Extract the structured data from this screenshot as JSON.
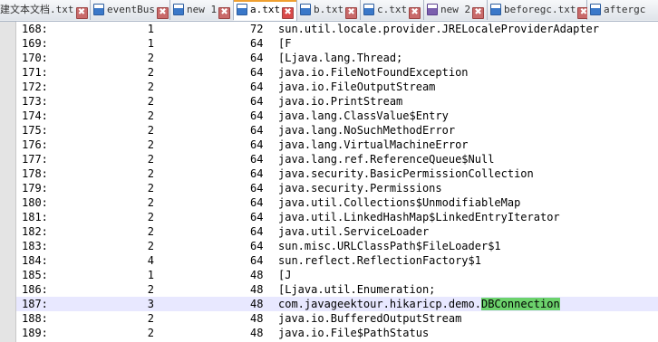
{
  "tabs": [
    {
      "label": "建文本文档.txt",
      "icon": "text-file-icon",
      "active": false
    },
    {
      "label": "eventBus",
      "icon": "text-file-icon",
      "active": false
    },
    {
      "label": "new 1",
      "icon": "text-file-icon",
      "active": false
    },
    {
      "label": "a.txt",
      "icon": "text-file-icon",
      "active": true
    },
    {
      "label": "b.txt",
      "icon": "text-file-icon",
      "active": false
    },
    {
      "label": "c.txt",
      "icon": "text-file-icon",
      "active": false
    },
    {
      "label": "new 2",
      "icon": "purple-file-icon",
      "active": false
    },
    {
      "label": "beforegc.txt",
      "icon": "text-file-icon",
      "active": false
    },
    {
      "label": "aftergc",
      "icon": "text-file-icon",
      "active": false
    }
  ],
  "close_glyph": "✖",
  "colors": {
    "active_tab_accent": "#f0a030",
    "current_line": "#e8e8ff",
    "search_highlight": "#6cd26c"
  },
  "lines": [
    {
      "num": "168:",
      "count": "1",
      "size": "72",
      "name": "sun.util.locale.provider.JRELocaleProviderAdapter"
    },
    {
      "num": "169:",
      "count": "1",
      "size": "64",
      "name": "[F"
    },
    {
      "num": "170:",
      "count": "2",
      "size": "64",
      "name": "[Ljava.lang.Thread;"
    },
    {
      "num": "171:",
      "count": "2",
      "size": "64",
      "name": "java.io.FileNotFoundException"
    },
    {
      "num": "172:",
      "count": "2",
      "size": "64",
      "name": "java.io.FileOutputStream"
    },
    {
      "num": "173:",
      "count": "2",
      "size": "64",
      "name": "java.io.PrintStream"
    },
    {
      "num": "174:",
      "count": "2",
      "size": "64",
      "name": "java.lang.ClassValue$Entry"
    },
    {
      "num": "175:",
      "count": "2",
      "size": "64",
      "name": "java.lang.NoSuchMethodError"
    },
    {
      "num": "176:",
      "count": "2",
      "size": "64",
      "name": "java.lang.VirtualMachineError"
    },
    {
      "num": "177:",
      "count": "2",
      "size": "64",
      "name": "java.lang.ref.ReferenceQueue$Null"
    },
    {
      "num": "178:",
      "count": "2",
      "size": "64",
      "name": "java.security.BasicPermissionCollection"
    },
    {
      "num": "179:",
      "count": "2",
      "size": "64",
      "name": "java.security.Permissions"
    },
    {
      "num": "180:",
      "count": "2",
      "size": "64",
      "name": "java.util.Collections$UnmodifiableMap"
    },
    {
      "num": "181:",
      "count": "2",
      "size": "64",
      "name": "java.util.LinkedHashMap$LinkedEntryIterator"
    },
    {
      "num": "182:",
      "count": "2",
      "size": "64",
      "name": "java.util.ServiceLoader"
    },
    {
      "num": "183:",
      "count": "2",
      "size": "64",
      "name": "sun.misc.URLClassPath$FileLoader$1"
    },
    {
      "num": "184:",
      "count": "4",
      "size": "64",
      "name": "sun.reflect.ReflectionFactory$1"
    },
    {
      "num": "185:",
      "count": "1",
      "size": "48",
      "name": "[J"
    },
    {
      "num": "186:",
      "count": "2",
      "size": "48",
      "name": "[Ljava.util.Enumeration;"
    },
    {
      "num": "187:",
      "count": "3",
      "size": "48",
      "name": "com.javageektour.hikaricp.demo.",
      "highlight": "DBConnection",
      "current": true
    },
    {
      "num": "188:",
      "count": "2",
      "size": "48",
      "name": "java.io.BufferedOutputStream"
    },
    {
      "num": "189:",
      "count": "2",
      "size": "48",
      "name": "java.io.File$PathStatus"
    }
  ]
}
